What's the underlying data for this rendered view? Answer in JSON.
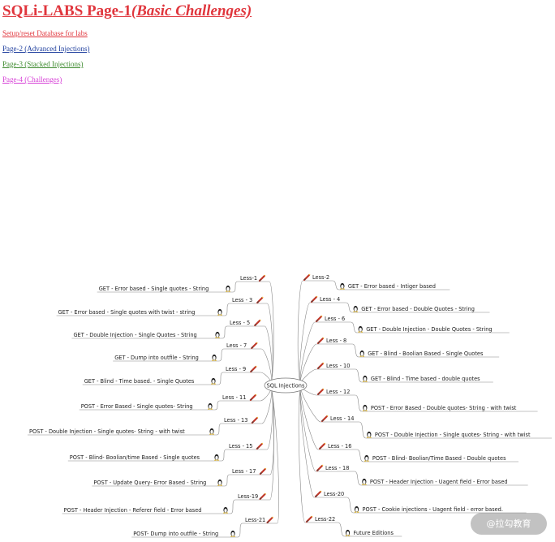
{
  "header": {
    "title_main": "SQLi-LABS Page-1",
    "title_sub": "(Basic Challenges)",
    "title_color": "#e0363d"
  },
  "links": [
    {
      "label": "Setup/reset Database for labs",
      "color": "#e0363d"
    },
    {
      "label": "Page-2 (Advanced Injections)",
      "color": "#1f3f9e"
    },
    {
      "label": "Page-3 (Stacked Injections)",
      "color": "#3d8a2e"
    },
    {
      "label": "Page-4 (Challenges)",
      "color": "#d63fd6"
    }
  ],
  "mindmap": {
    "center": "SQL Injections",
    "left": [
      {
        "less": "Less-1",
        "desc": "GET - Error based - Single quotes - String"
      },
      {
        "less": "Less - 3",
        "desc": "GET - Error based - Single quotes with twist - string"
      },
      {
        "less": "Less - 5",
        "desc": "GET - Double Injection - Single Quotes - String"
      },
      {
        "less": "Less - 7",
        "desc": "GET - Dump into outfile - String"
      },
      {
        "less": "Less - 9",
        "desc": "GET - Blind - Time based. -  Single Quotes"
      },
      {
        "less": "Less - 11",
        "desc": "POST - Error Based - Single quotes- String"
      },
      {
        "less": "Less - 13",
        "desc": "POST - Double Injection - Single quotes- String - with twist"
      },
      {
        "less": "Less - 15",
        "desc": "POST - Blind- Boolian/time Based - Single quotes"
      },
      {
        "less": "Less - 17",
        "desc": "POST - Update Query- Error Based - String"
      },
      {
        "less": "Less-19",
        "desc": "POST - Header Injection - Referer field - Error based"
      },
      {
        "less": "Less-21",
        "desc": "POST- Dump into outfile - String"
      }
    ],
    "right": [
      {
        "less": "Less-2",
        "desc": "GET - Error based - Intiger based"
      },
      {
        "less": "Less - 4",
        "desc": "GET - Error based - Double Quotes - String"
      },
      {
        "less": "Less - 6",
        "desc": "GET - Double Injection - Double Quotes - String"
      },
      {
        "less": "Less - 8",
        "desc": "GET - Blind - Boolian Based - Single Quotes"
      },
      {
        "less": "Less - 10",
        "desc": "GET - Blind - Time based - double quotes"
      },
      {
        "less": "Less - 12",
        "desc": "POST - Error Based - Double quotes- String - with twist"
      },
      {
        "less": "Less - 14",
        "desc": "POST - Double Injection - Single quotes- String - with twist"
      },
      {
        "less": "Less - 16",
        "desc": "POST - Blind- Boolian/Time Based - Double quotes"
      },
      {
        "less": "Less - 18",
        "desc": "POST - Header Injection - Uagent field - Error based"
      },
      {
        "less": "Less-20",
        "desc": "POST - Cookie injections - Uagent field - error based."
      },
      {
        "less": "Less-22",
        "desc": "Future Editions"
      }
    ]
  },
  "watermark": "@拉勾教育",
  "icons": {
    "less_icon": "pencil-icon",
    "desc_icon": "linux-penguin-icon"
  }
}
